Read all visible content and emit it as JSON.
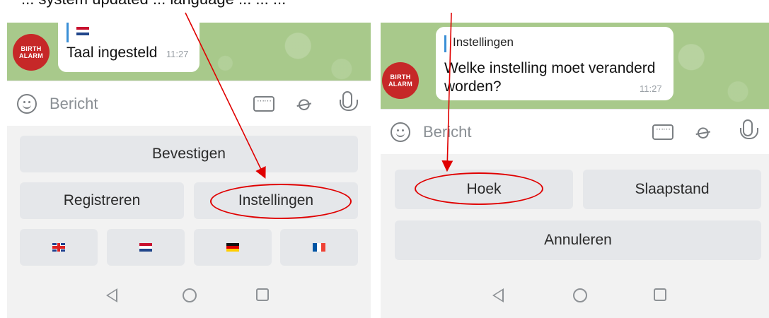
{
  "caption": "... system updated ... language ... ... ...",
  "left": {
    "avatar_line1": "BIRTH",
    "avatar_line2": "ALARM",
    "message_text": "Taal ingesteld",
    "message_time": "11:27",
    "input_placeholder": "Bericht",
    "buttons": {
      "confirm": "Bevestigen",
      "register": "Registreren",
      "settings": "Instellingen"
    }
  },
  "right": {
    "avatar_line1": "BIRTH",
    "avatar_line2": "ALARM",
    "quote_title": "Instellingen",
    "message_text": "Welke instelling moet veranderd worden?",
    "message_time": "11:27",
    "input_placeholder": "Bericht",
    "buttons": {
      "angle": "Hoek",
      "sleep_mode": "Slaapstand",
      "cancel": "Annuleren"
    }
  },
  "colors": {
    "chat_bg": "#a8c98b",
    "avatar_red": "#c62828",
    "quote_blue": "#3a8fd6",
    "annotation_red": "#e00000",
    "key_bg": "#e5e7ea"
  }
}
